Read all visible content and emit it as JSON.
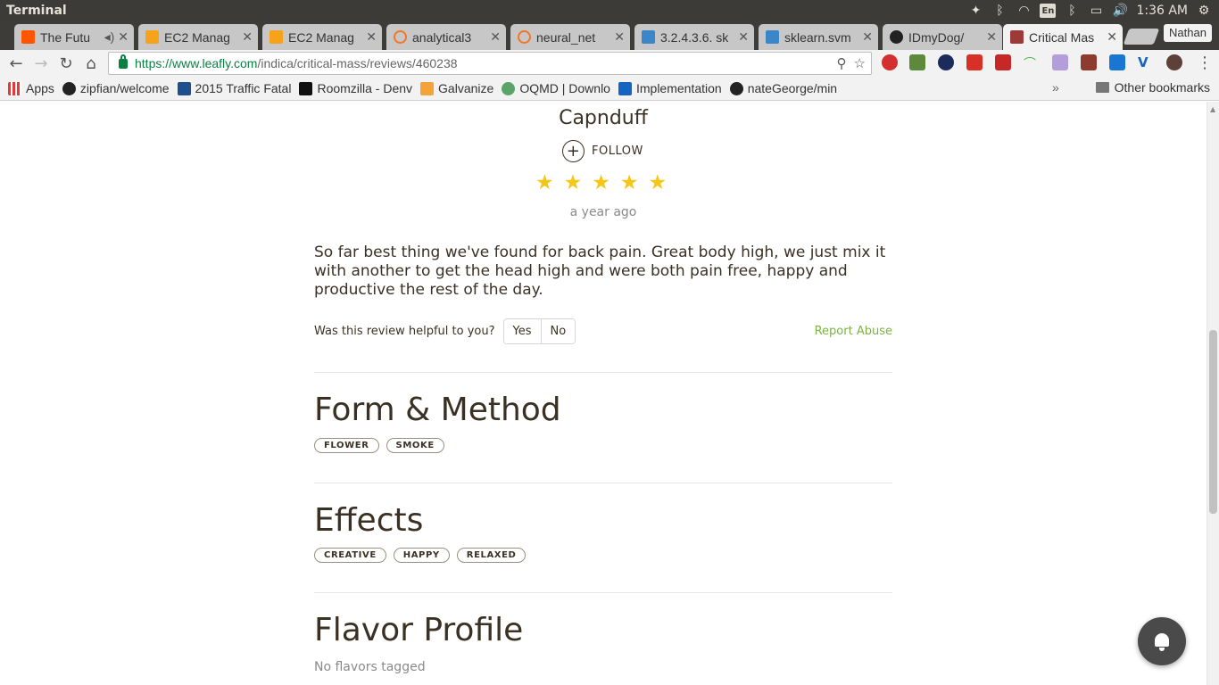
{
  "os": {
    "window_title": "Terminal",
    "lang": "En",
    "time": "1:36 AM"
  },
  "browser": {
    "tabs": [
      {
        "title": "The Futu",
        "favicon_color": "#ff5500"
      },
      {
        "title": "EC2 Manag",
        "favicon_color": "#f7a21b"
      },
      {
        "title": "EC2 Manag",
        "favicon_color": "#f7a21b"
      },
      {
        "title": "analytical3",
        "favicon_color": "#f37626"
      },
      {
        "title": "neural_net",
        "favicon_color": "#f37626"
      },
      {
        "title": "3.2.4.3.6. sk",
        "favicon_color": "#3a86c8"
      },
      {
        "title": "sklearn.svm",
        "favicon_color": "#3a86c8"
      },
      {
        "title": "IDmyDog/",
        "favicon_color": "#222222"
      },
      {
        "title": "Critical Mas",
        "favicon_color": "#9c3a3a"
      }
    ],
    "profile_name": "Nathan",
    "url_scheme_host": "https://www.leafly.com",
    "url_path": "/indica/critical-mass/reviews/460238",
    "bookmarks": [
      {
        "label": "Apps",
        "icon": "apps-grid-icon"
      },
      {
        "label": "zipfian/welcome",
        "icon": "github-icon"
      },
      {
        "label": "2015 Traffic Fatal",
        "icon": "page-icon"
      },
      {
        "label": "Roomzilla - Denv",
        "icon": "page-icon"
      },
      {
        "label": "Galvanize",
        "icon": "page-icon"
      },
      {
        "label": "OQMD | Downlo",
        "icon": "page-icon"
      },
      {
        "label": "Implementation",
        "icon": "page-icon"
      },
      {
        "label": "nateGeorge/min",
        "icon": "github-icon"
      }
    ],
    "other_bookmarks": "Other bookmarks"
  },
  "review": {
    "username": "Capnduff",
    "follow_label": "FOLLOW",
    "rating": 5,
    "rating_max": 5,
    "time_ago": "a year ago",
    "text": "So far best thing we've found for back pain. Great body high, we just mix it with another to get the head high and were both pain free, happy and productive the rest of the day.",
    "helpful_question": "Was this review helpful to you?",
    "yes_label": "Yes",
    "no_label": "No",
    "report_label": "Report Abuse"
  },
  "sections": {
    "form_method": {
      "title": "Form & Method",
      "tags": [
        "FLOWER",
        "SMOKE"
      ]
    },
    "effects": {
      "title": "Effects",
      "tags": [
        "CREATIVE",
        "HAPPY",
        "RELAXED"
      ]
    },
    "flavor": {
      "title": "Flavor Profile",
      "empty_text": "No flavors tagged"
    }
  },
  "colors": {
    "star": "#f5c518",
    "report_link": "#7cb342",
    "text": "#3b3024",
    "secure_url": "#0b8043"
  }
}
